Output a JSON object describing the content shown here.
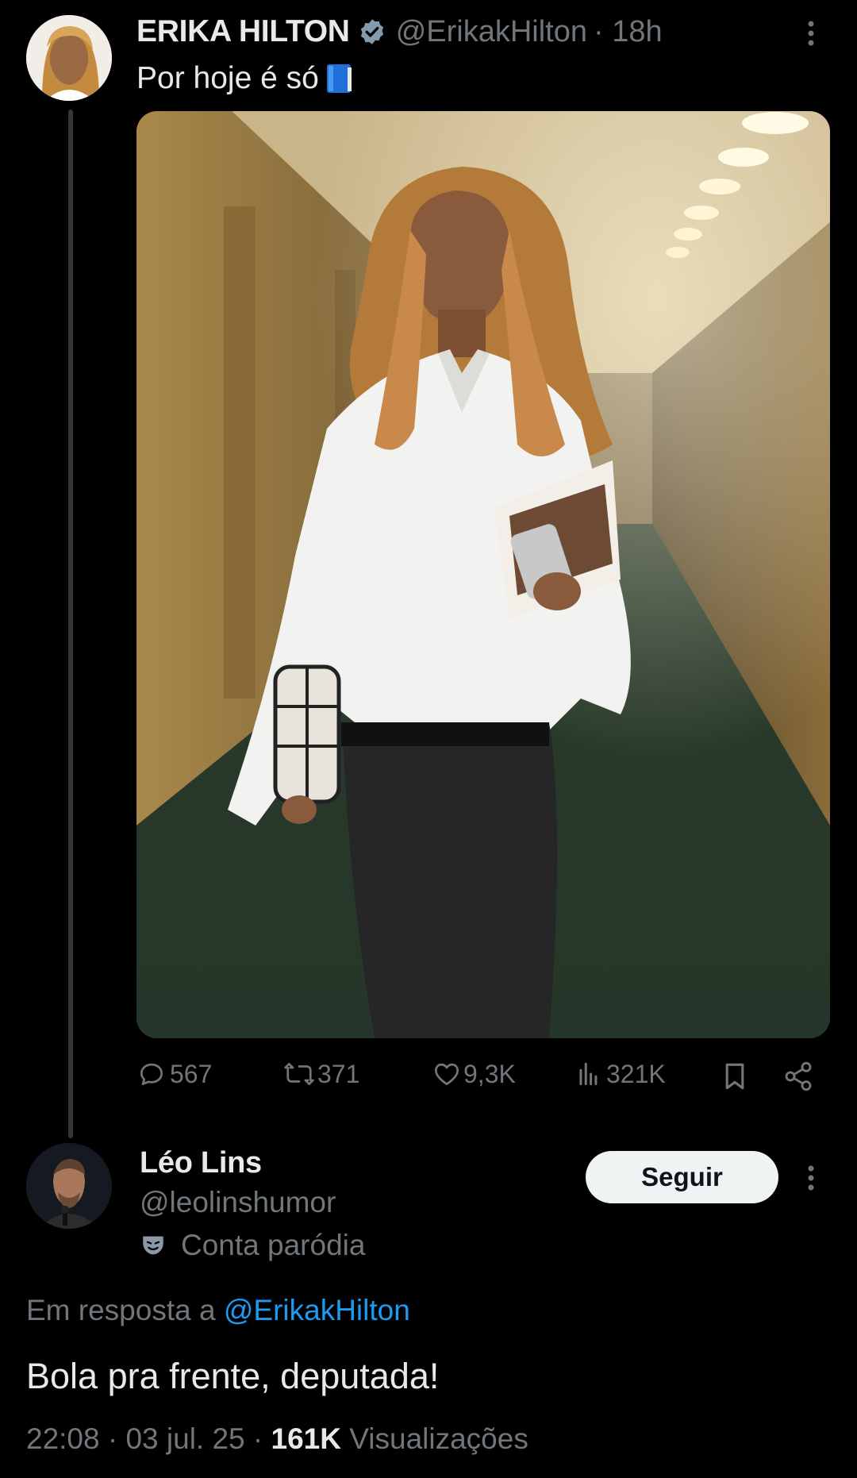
{
  "original_tweet": {
    "author_name": "ERIKA HILTON",
    "handle": "@ErikakHilton",
    "time": "· 18h",
    "text": "Por hoje é só",
    "emoji": "blue-book",
    "actions": {
      "replies": "567",
      "retweets": "371",
      "likes": "9,3K",
      "views": "321K"
    }
  },
  "reply": {
    "author_name": "Léo Lins",
    "handle": "@leolinshumor",
    "parody_label": "Conta paródia",
    "follow_label": "Seguir",
    "in_reply_prefix": "Em resposta a",
    "in_reply_handle": "@ErikakHilton",
    "text": "Bola pra frente, deputada!",
    "timestamp": "22:08 · 03 jul. 25 ·",
    "views_count": "161K",
    "views_label": "Visualizações"
  },
  "colors": {
    "background": "#000000",
    "text_primary": "#e7e9ea",
    "text_secondary": "#71767b",
    "accent_blue": "#1d9bf0",
    "verified_badge": "#829aab",
    "follow_button": "#eff3f4"
  }
}
